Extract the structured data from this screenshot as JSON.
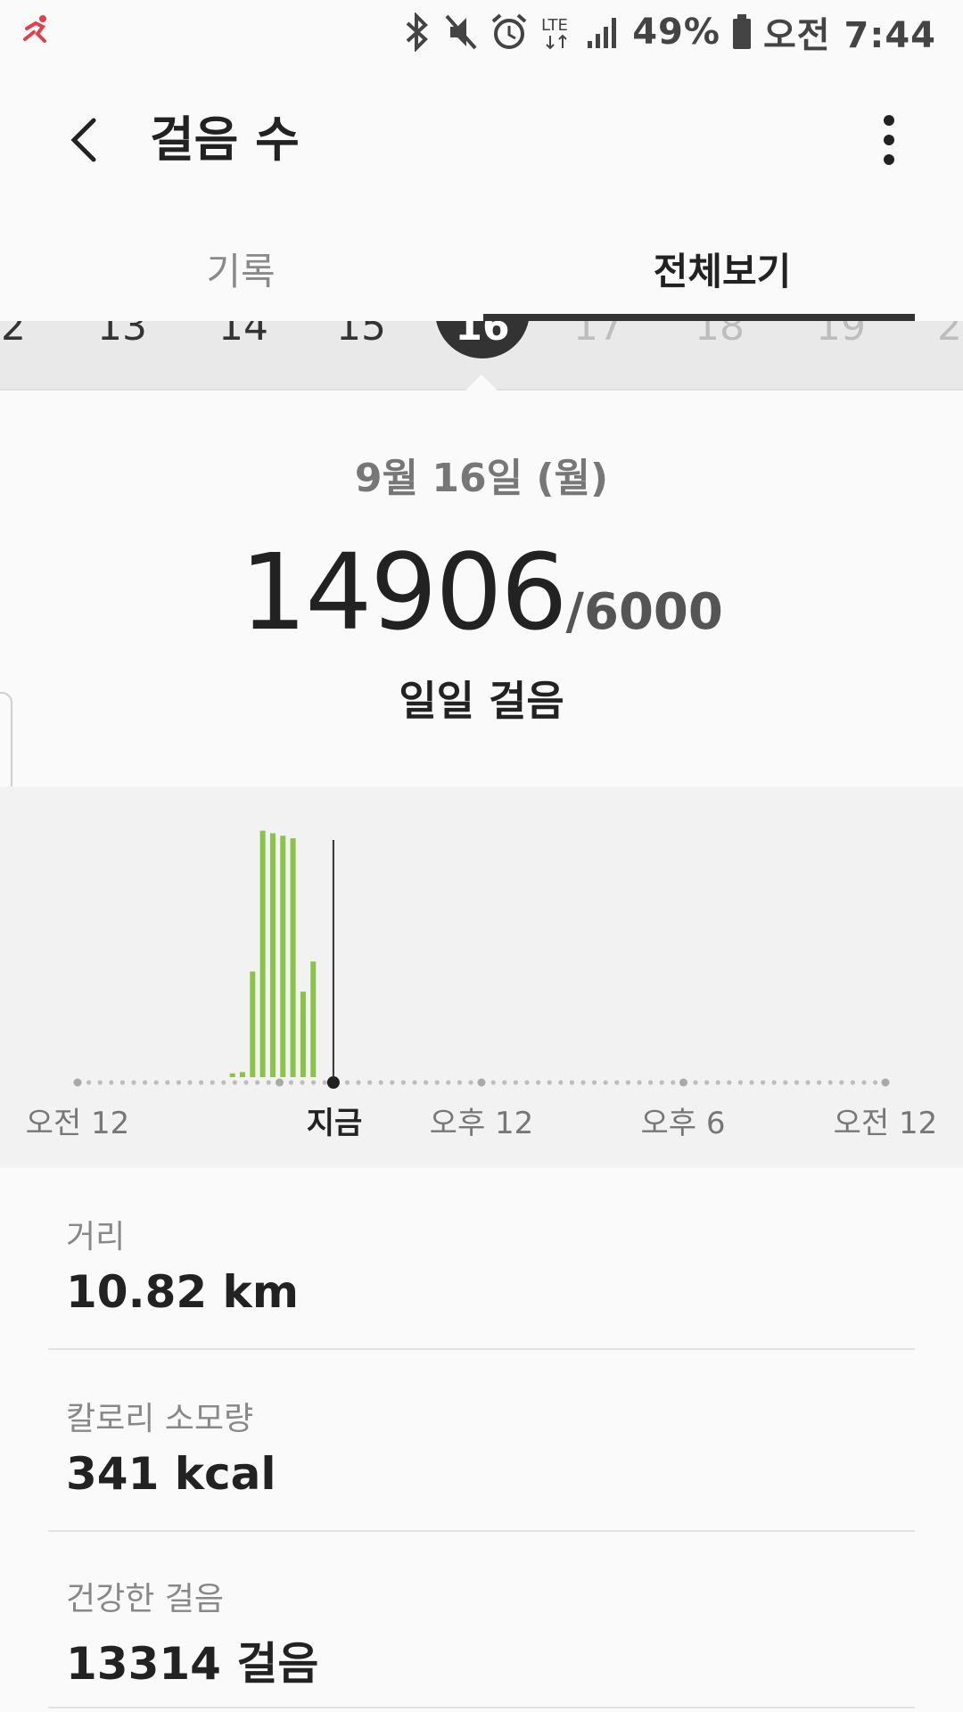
{
  "status": {
    "battery": "49%",
    "time": "오전 7:44",
    "network": "LTE"
  },
  "appbar": {
    "title": "걸음 수"
  },
  "tabs": [
    {
      "label": "기록",
      "active": false
    },
    {
      "label": "전체보기",
      "active": true
    }
  ],
  "day_strip": {
    "days": [
      "2",
      "13",
      "14",
      "15",
      "16",
      "17",
      "18",
      "19",
      "2"
    ],
    "selected": "16"
  },
  "summary": {
    "date": "9월 16일 (월)",
    "steps": "14906",
    "goal": "/6000",
    "caption": "일일 걸음"
  },
  "chart_data": {
    "type": "bar",
    "x_unit": "hour",
    "xlim": [
      0,
      24
    ],
    "values": [
      {
        "hour": 4.6,
        "value": 1.5
      },
      {
        "hour": 4.9,
        "value": 2
      },
      {
        "hour": 5.2,
        "value": 42
      },
      {
        "hour": 5.5,
        "value": 98
      },
      {
        "hour": 5.8,
        "value": 97
      },
      {
        "hour": 6.1,
        "value": 96
      },
      {
        "hour": 6.4,
        "value": 95
      },
      {
        "hour": 6.7,
        "value": 34
      },
      {
        "hour": 7.0,
        "value": 46
      }
    ],
    "now_hour": 7.6,
    "tick_labels": [
      "오전 12",
      "지금",
      "오후 12",
      "오후 6",
      "오전 12"
    ],
    "series_color": "#8bc34a"
  },
  "stats": [
    {
      "label": "거리",
      "value": "10.82 km"
    },
    {
      "label": "칼로리 소모량",
      "value": "341 kcal"
    },
    {
      "label": "건강한 걸음",
      "value": "13314 걸음"
    }
  ]
}
